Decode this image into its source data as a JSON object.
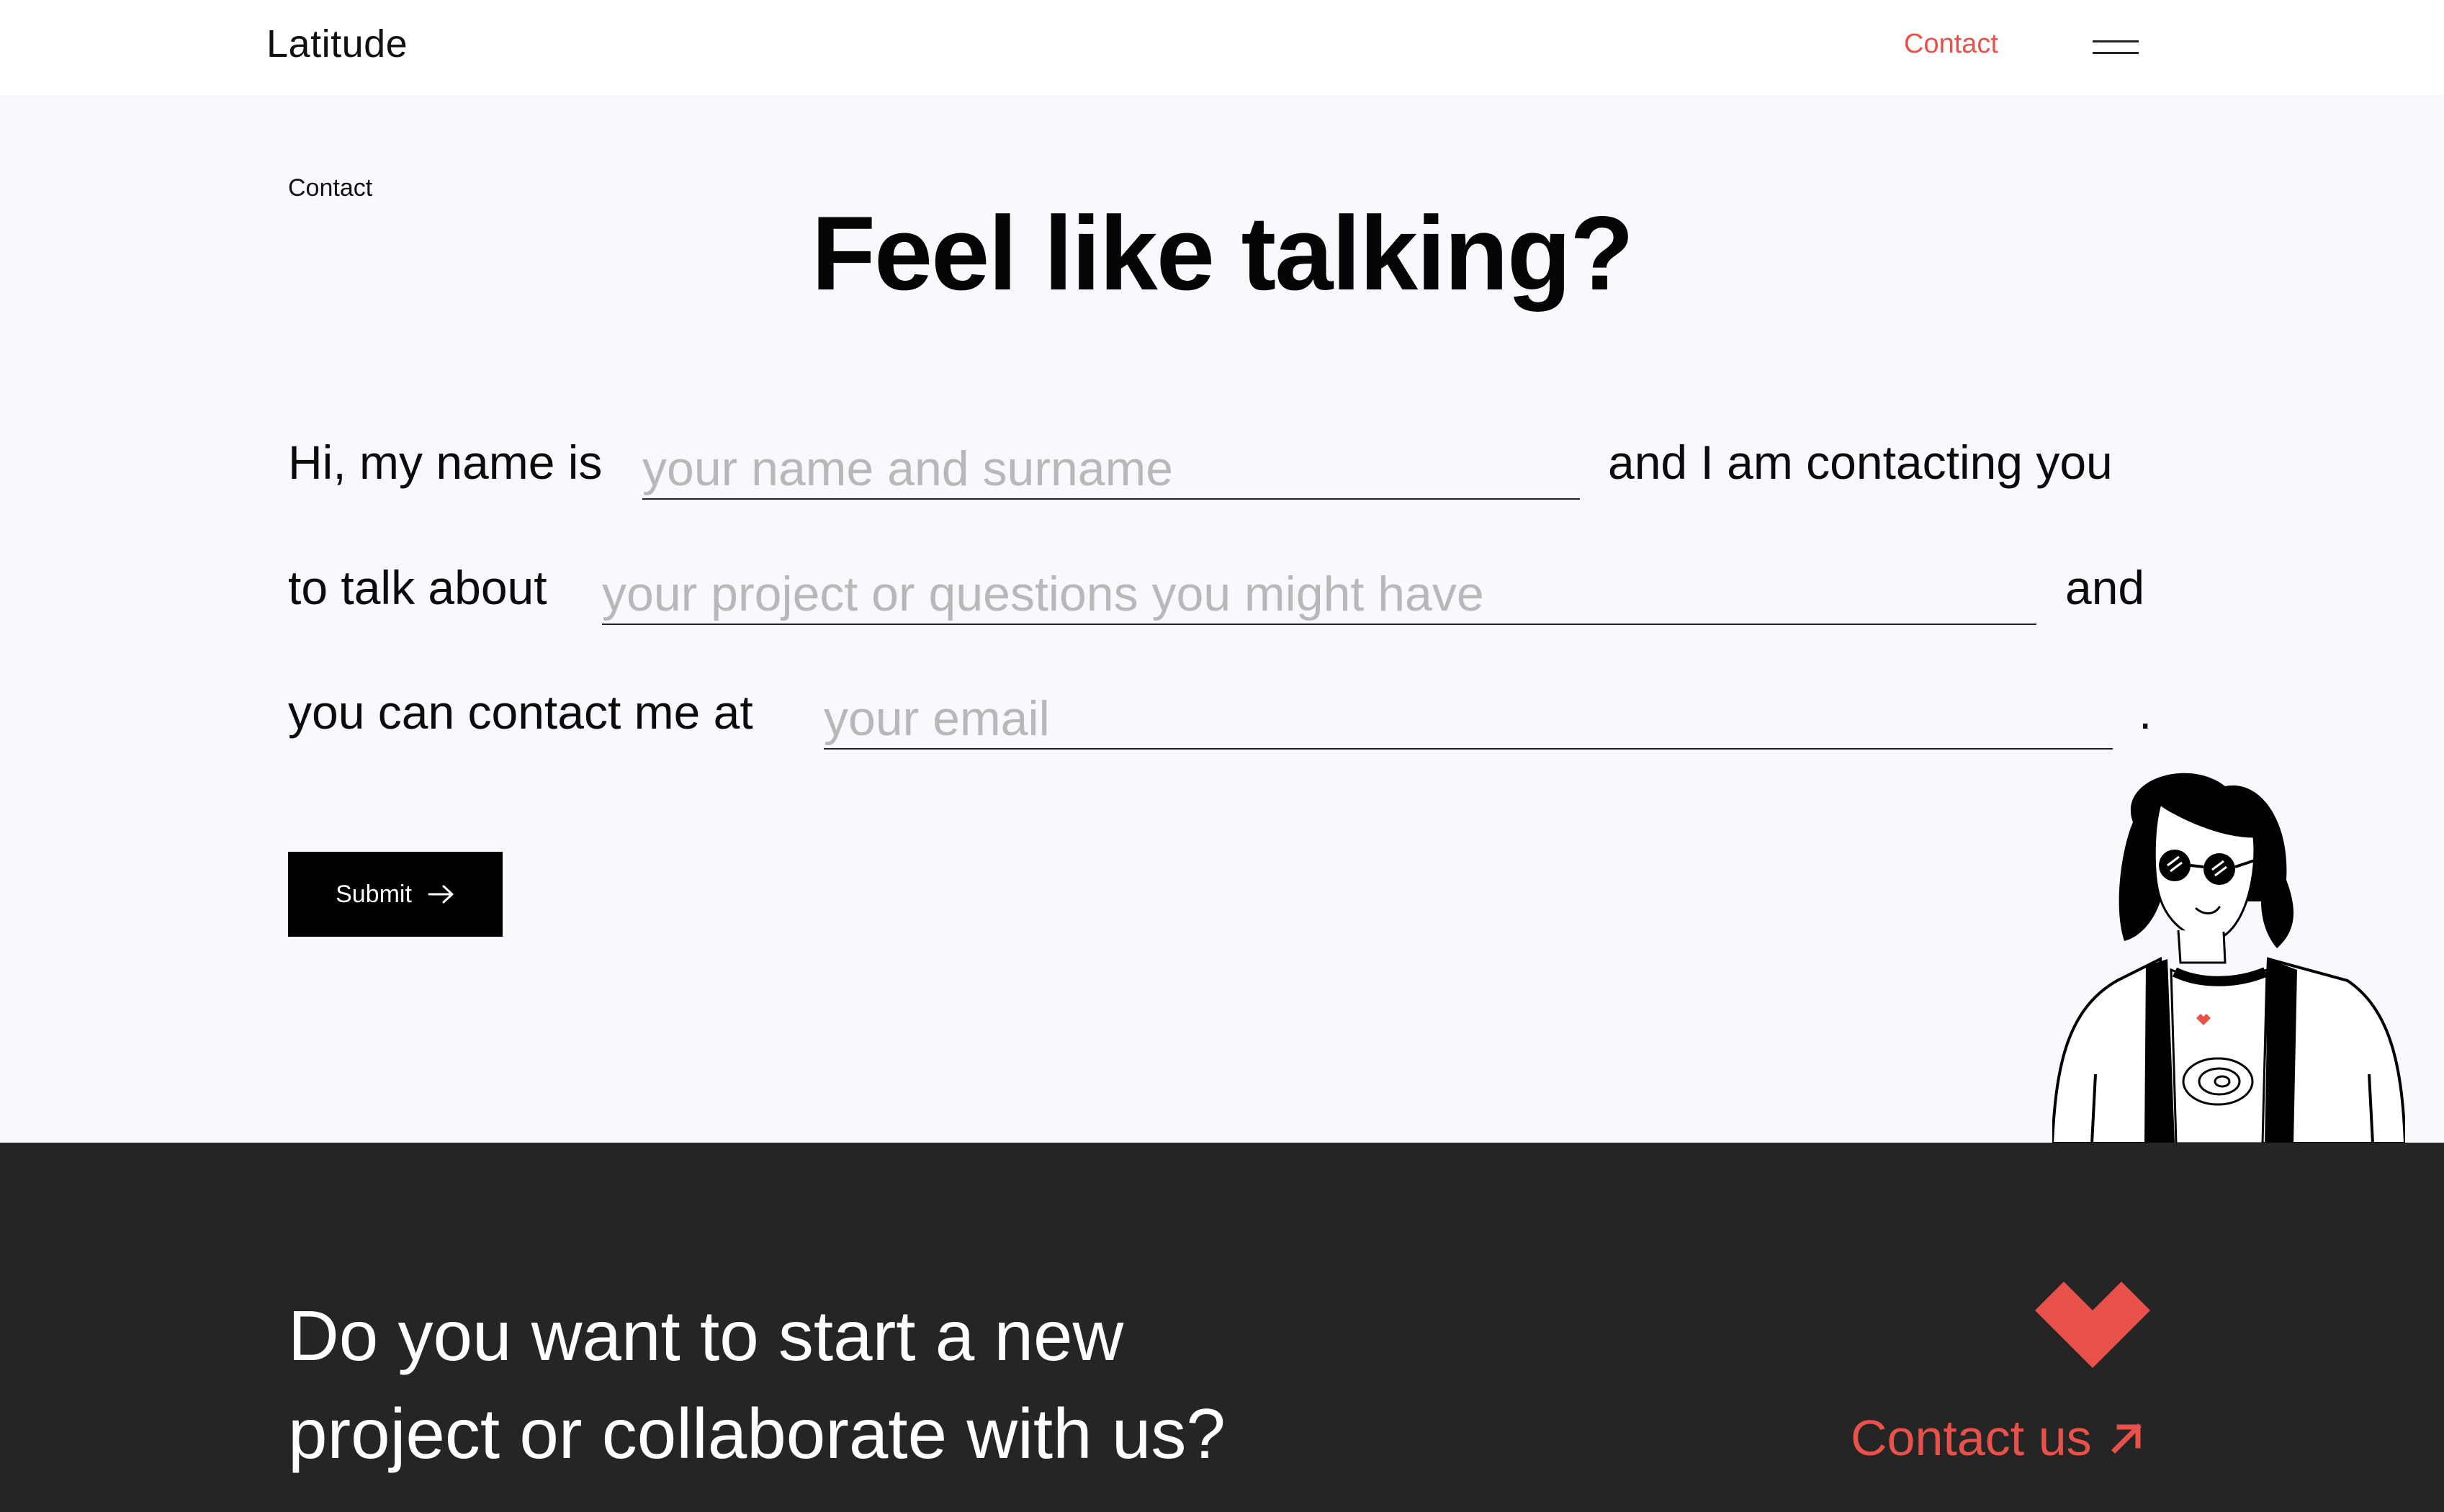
{
  "header": {
    "logo": "Latitude",
    "nav_contact": "Contact",
    "menu_icon": "hamburger-menu-icon"
  },
  "page": {
    "breadcrumb": "Contact",
    "title": "Feel like talking?"
  },
  "form": {
    "line1_prefix": "Hi, my name is",
    "name_placeholder": "your name and surname",
    "line1_suffix": "and I am contacting you",
    "line2_prefix": "to talk about",
    "topic_placeholder": "your project or questions you might have",
    "line2_suffix": "and",
    "line3_prefix": "you can contact me at",
    "email_placeholder": "your email",
    "line3_suffix": ".",
    "submit_label": "Submit",
    "submit_icon": "arrow-right-icon"
  },
  "illustration": {
    "name": "woman-with-sunglasses-illustration"
  },
  "footer": {
    "cta_line1": "Do you want to start a new",
    "cta_line2": "project or collaborate with us?",
    "contact_label": "Contact us",
    "heart_icon": "heart-icon",
    "link_icon": "arrow-up-right-icon"
  },
  "colors": {
    "accent": "#e9524a",
    "footer_bg": "#252525",
    "page_bg": "#f8f9fd",
    "header_bg": "#ffffff"
  }
}
